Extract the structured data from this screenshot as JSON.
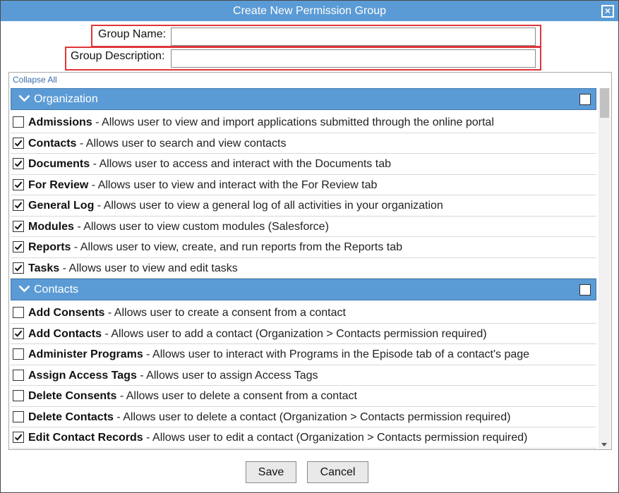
{
  "dialog": {
    "title": "Create New Permission Group",
    "close_label": "×"
  },
  "form": {
    "group_name_label": "Group Name:",
    "group_name_value": "",
    "group_description_label": "Group Description:",
    "group_description_value": ""
  },
  "permissions": {
    "collapse_all_label": "Collapse All",
    "sections": [
      {
        "title": "Organization",
        "checked": false,
        "items": [
          {
            "name": "Admissions",
            "desc": " - Allows user to view and import applications submitted through the online portal",
            "checked": false
          },
          {
            "name": "Contacts",
            "desc": " - Allows user to search and view contacts",
            "checked": true
          },
          {
            "name": "Documents",
            "desc": " - Allows user to access and interact with the Documents tab",
            "checked": true
          },
          {
            "name": "For Review",
            "desc": " - Allows user to view and interact with the For Review tab",
            "checked": true
          },
          {
            "name": "General Log",
            "desc": " - Allows user to view a general log of all activities in your organization",
            "checked": true
          },
          {
            "name": "Modules",
            "desc": " - Allows user to view custom modules (Salesforce)",
            "checked": true
          },
          {
            "name": "Reports",
            "desc": " - Allows user to view, create, and run reports from the Reports tab",
            "checked": true
          },
          {
            "name": "Tasks",
            "desc": " - Allows user to view and edit tasks",
            "checked": true
          }
        ]
      },
      {
        "title": "Contacts",
        "checked": false,
        "items": [
          {
            "name": "Add Consents",
            "desc": " - Allows user to create a consent from a contact",
            "checked": false
          },
          {
            "name": "Add Contacts",
            "desc": " - Allows user to add a contact (Organization > Contacts permission required)",
            "checked": true
          },
          {
            "name": "Administer Programs",
            "desc": " - Allows user to interact with Programs in the Episode tab of a contact's page",
            "checked": false
          },
          {
            "name": "Assign Access Tags",
            "desc": " - Allows user to assign Access Tags",
            "checked": false
          },
          {
            "name": "Delete Consents",
            "desc": " - Allows user to delete a consent from a contact",
            "checked": false
          },
          {
            "name": "Delete Contacts",
            "desc": " - Allows user to delete a contact (Organization > Contacts permission required)",
            "checked": false
          },
          {
            "name": "Edit Contact Records",
            "desc": " - Allows user to edit a contact (Organization > Contacts permission required)",
            "checked": true
          }
        ]
      }
    ]
  },
  "footer": {
    "save_label": "Save",
    "cancel_label": "Cancel"
  }
}
